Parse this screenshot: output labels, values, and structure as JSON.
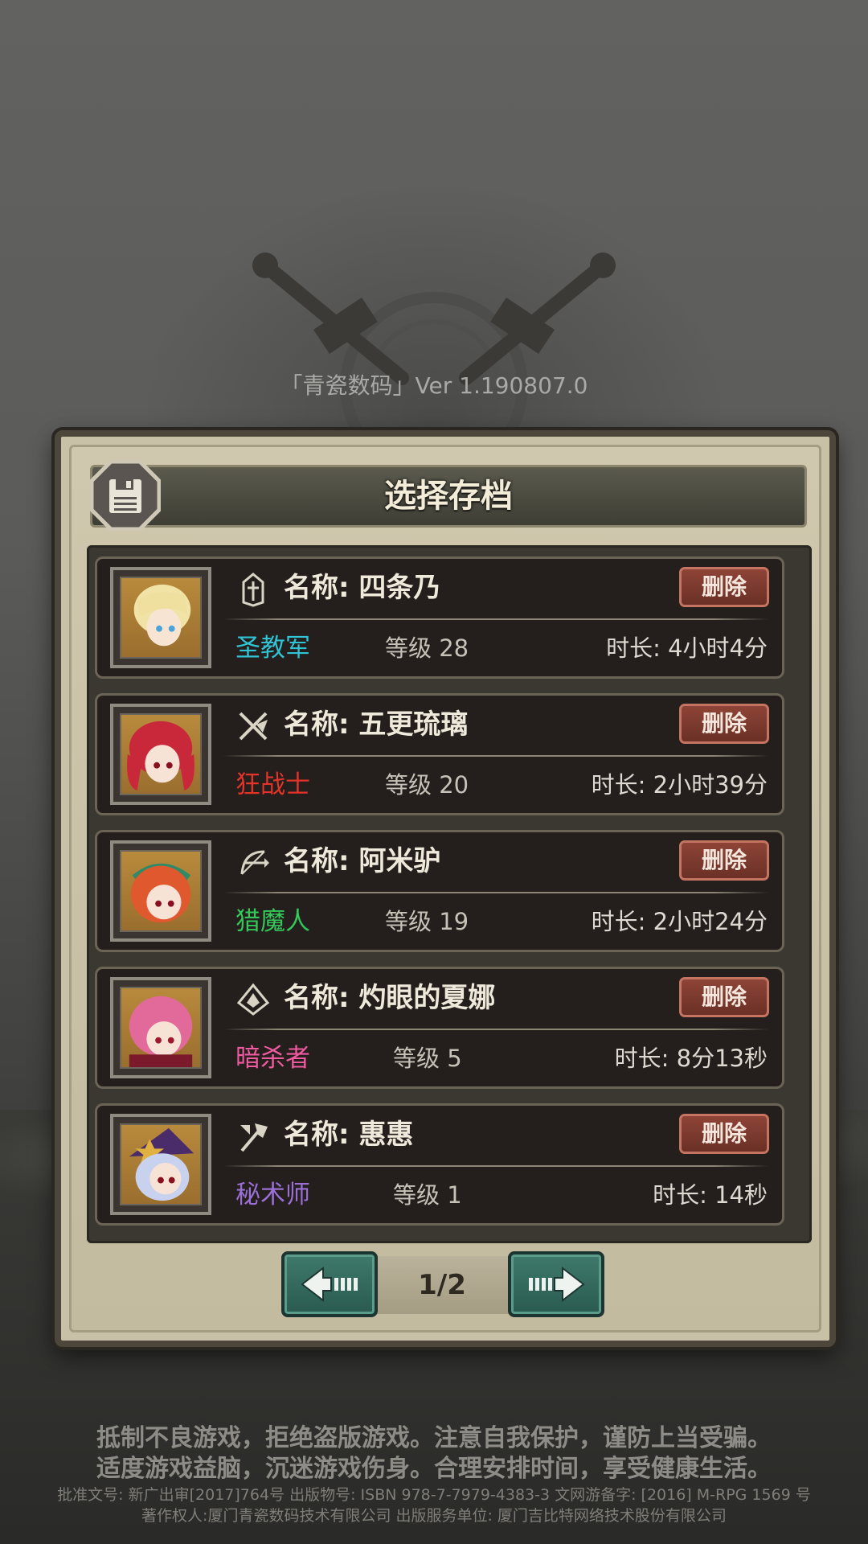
{
  "version_text": "「青瓷数码」Ver 1.190807.0",
  "dialog": {
    "title": "选择存档",
    "icon": "floppy-disk-icon"
  },
  "slots": [
    {
      "name": "名称: 四条乃",
      "class": "圣教军",
      "class_color": "#2fc3d4",
      "level": "等级 28",
      "duration": "时长: 4小时4分",
      "delete_label": "删除",
      "class_icon": "cross-shield-icon"
    },
    {
      "name": "名称: 五更琉璃",
      "class": "狂战士",
      "class_color": "#e3342a",
      "level": "等级 20",
      "duration": "时长: 2小时39分",
      "delete_label": "删除",
      "class_icon": "crossed-blades-icon"
    },
    {
      "name": "名称: 阿米驴",
      "class": "猎魔人",
      "class_color": "#33c95a",
      "level": "等级 19",
      "duration": "时长: 2小时24分",
      "delete_label": "删除",
      "class_icon": "bow-icon"
    },
    {
      "name": "名称: 灼眼的夏娜",
      "class": "暗杀者",
      "class_color": "#f05aa0",
      "level": "等级 5",
      "duration": "时长: 8分13秒",
      "delete_label": "删除",
      "class_icon": "assassin-emblem-icon"
    },
    {
      "name": "名称: 惠惠",
      "class": "秘术师",
      "class_color": "#9a6fd6",
      "level": "等级 1",
      "duration": "时长: 14秒",
      "delete_label": "删除",
      "class_icon": "staff-icon"
    }
  ],
  "pager": {
    "page_text": "1/2",
    "prev_icon": "arrow-left-icon",
    "next_icon": "arrow-right-icon"
  },
  "footer": {
    "line1": "抵制不良游戏，拒绝盗版游戏。注意自我保护，谨防上当受骗。",
    "line2": "适度游戏益脑，沉迷游戏伤身。合理安排时间，享受健康生活。",
    "line3": "批准文号: 新广出审[2017]764号 出版物号: ISBN 978-7-7979-4383-3 文网游备字: [2016] M-RPG 1569 号",
    "line4": "著作权人:厦门青瓷数码技术有限公司 出版服务单位: 厦门吉比特网络技术股份有限公司"
  }
}
